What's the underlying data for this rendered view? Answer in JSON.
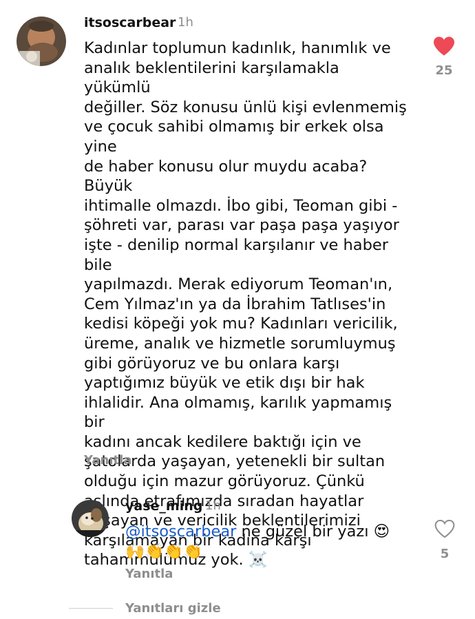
{
  "comment": {
    "username": "itsoscarbear",
    "time": "1h",
    "text": "Kadınlar toplumun kadınlık, hanımlık ve\nanalık beklentilerini karşılamakla yükümlü\ndeğiller. Söz konusu ünlü kişi evlenmemiş\nve çocuk sahibi olmamış bir erkek olsa yine\nde haber konusu olur muydu acaba? Büyük\nihtimalle olmazdı. İbo gibi, Teoman gibi -\nşöhreti var, parası var paşa paşa yaşıyor\nişte - denilip normal karşılanır ve haber bile\nyapılmazdı. Merak ediyorum Teoman'ın,\nCem Yılmaz'ın ya da İbrahim Tatlıses'in\nkedisi köpeği yok mu? Kadınları vericilik,\nüreme, analık ve hizmetle sorumluymuş\ngibi görüyoruz ve bu onlara karşı\nyaptığımız büyük ve etik dışı bir hak\nihlalidir. Ana olmamış, karılık yapmamış bir\nkadını ancak kedilere baktığı için ve\nşatolarda yaşayan, yetenekli bir sultan\nolduğu için mazur görüyoruz. Çünkü\naslında etrafımızda sıradan hayatlar\nyaşayan ve vericilik beklentilerimizi\nkarşılamayan bir kadına karşı\ntahammülümüz yok.",
    "emoji": "☠️",
    "reply_label": "Yanıtla",
    "like_count": "25",
    "liked_color": "#ed4956"
  },
  "reply": {
    "username": "yase_ming",
    "time": "1h",
    "mention": "@itsoscarbear",
    "text": " ne güzel bir yazı 😍",
    "emojis": "🙌👏👏👏",
    "reply_label": "Yanıtla",
    "like_count": "5"
  },
  "hide_replies_label": "Yanıtları gizle"
}
